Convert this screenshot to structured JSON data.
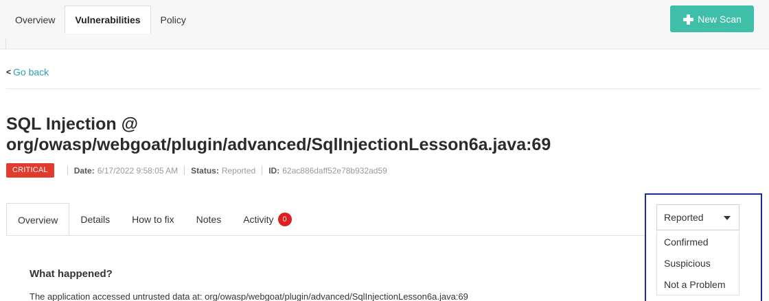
{
  "topnav": {
    "tabs": [
      {
        "label": "Overview"
      },
      {
        "label": "Vulnerabilities"
      },
      {
        "label": "Policy"
      }
    ],
    "new_scan_label": "New Scan"
  },
  "nav": {
    "go_back_label": "Go back"
  },
  "vulnerability": {
    "title_line1": "SQL Injection @",
    "title_line2": "org/owasp/webgoat/plugin/advanced/SqlInjectionLesson6a.java:69",
    "severity": "CRITICAL",
    "date_label": "Date:",
    "date_value": "6/17/2022 9:58:05 AM",
    "status_label": "Status:",
    "status_value": "Reported",
    "id_label": "ID:",
    "id_value": "62ac886daff52e78b932ad59"
  },
  "detail_tabs": {
    "overview": "Overview",
    "details": "Details",
    "how_to_fix": "How to fix",
    "notes": "Notes",
    "activity": "Activity",
    "activity_count": "0"
  },
  "status_dropdown": {
    "selected": "Reported",
    "options": [
      "Confirmed",
      "Suspicious",
      "Not a Problem"
    ]
  },
  "content": {
    "heading": "What happened?",
    "text": "The application accessed untrusted data at: org/owasp/webgoat/plugin/advanced/SqlInjectionLesson6a.java:69"
  },
  "colors": {
    "accent": "#3fbfa9",
    "link": "#2c9fb2",
    "critical": "#e23b2e",
    "highlight": "#1b2a9e"
  }
}
